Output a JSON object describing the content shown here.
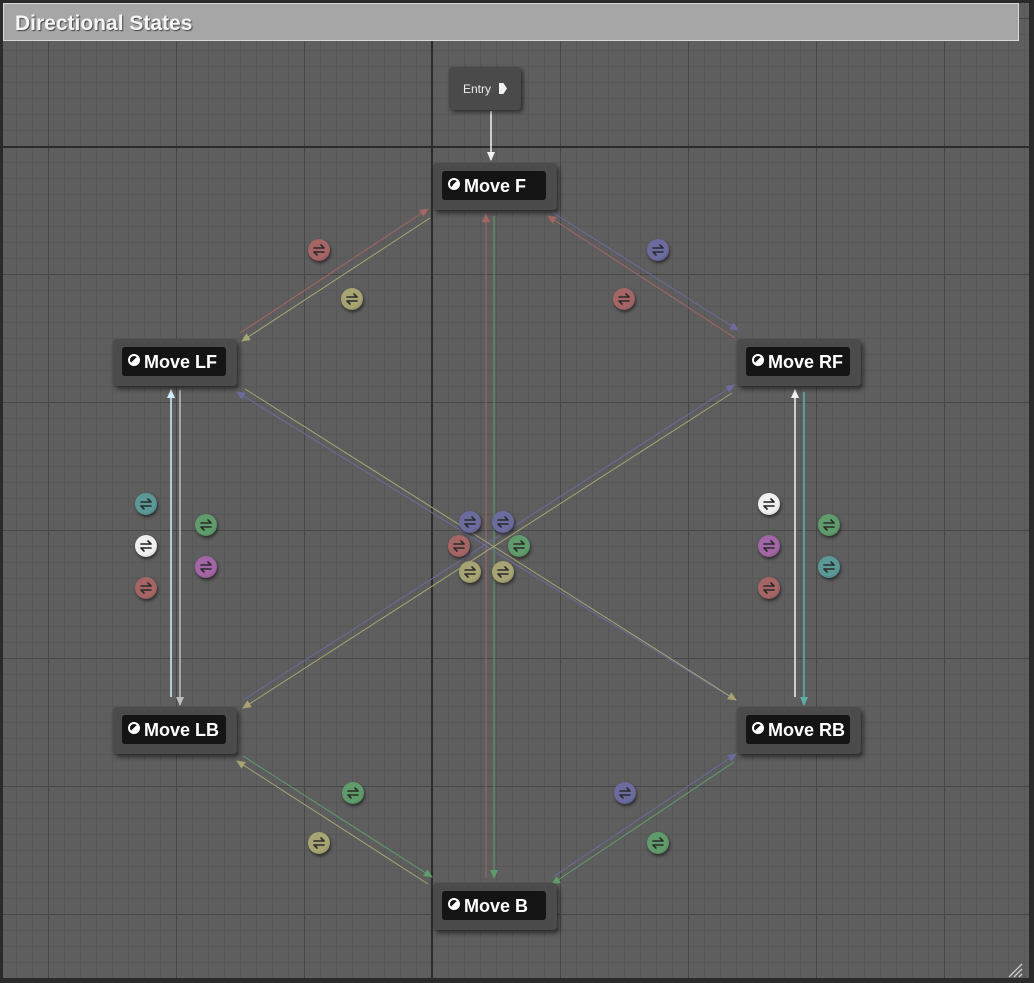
{
  "title": "Directional States",
  "entry": {
    "label": "Entry"
  },
  "states": [
    {
      "id": "f",
      "label": "Move F"
    },
    {
      "id": "lf",
      "label": "Move LF"
    },
    {
      "id": "rf",
      "label": "Move RF"
    },
    {
      "id": "lb",
      "label": "Move LB"
    },
    {
      "id": "rb",
      "label": "Move RB"
    },
    {
      "id": "b",
      "label": "Move B"
    }
  ],
  "colors": {
    "red": "#a56565",
    "olive": "#a6a473",
    "blue": "#6b6b9e",
    "green": "#609c6b",
    "teal": "#5b9898",
    "purple": "#a265a6",
    "white": "#f0f0f0"
  },
  "icons": {
    "state": "state-half-circle-icon",
    "entry_pin": "exec-pin-icon",
    "transition_rule": "transition-rule-icon",
    "resize": "resize-grip-icon"
  }
}
